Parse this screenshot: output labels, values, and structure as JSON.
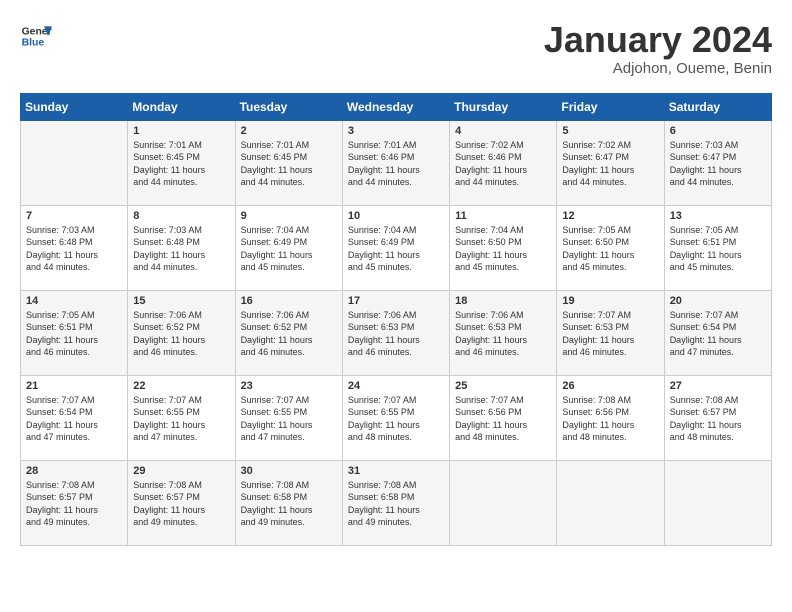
{
  "logo": {
    "line1": "General",
    "line2": "Blue"
  },
  "header": {
    "title": "January 2024",
    "subtitle": "Adjohon, Oueme, Benin"
  },
  "weekdays": [
    "Sunday",
    "Monday",
    "Tuesday",
    "Wednesday",
    "Thursday",
    "Friday",
    "Saturday"
  ],
  "weeks": [
    [
      {
        "day": "",
        "info": ""
      },
      {
        "day": "1",
        "info": "Sunrise: 7:01 AM\nSunset: 6:45 PM\nDaylight: 11 hours\nand 44 minutes."
      },
      {
        "day": "2",
        "info": "Sunrise: 7:01 AM\nSunset: 6:45 PM\nDaylight: 11 hours\nand 44 minutes."
      },
      {
        "day": "3",
        "info": "Sunrise: 7:01 AM\nSunset: 6:46 PM\nDaylight: 11 hours\nand 44 minutes."
      },
      {
        "day": "4",
        "info": "Sunrise: 7:02 AM\nSunset: 6:46 PM\nDaylight: 11 hours\nand 44 minutes."
      },
      {
        "day": "5",
        "info": "Sunrise: 7:02 AM\nSunset: 6:47 PM\nDaylight: 11 hours\nand 44 minutes."
      },
      {
        "day": "6",
        "info": "Sunrise: 7:03 AM\nSunset: 6:47 PM\nDaylight: 11 hours\nand 44 minutes."
      }
    ],
    [
      {
        "day": "7",
        "info": "Sunrise: 7:03 AM\nSunset: 6:48 PM\nDaylight: 11 hours\nand 44 minutes."
      },
      {
        "day": "8",
        "info": "Sunrise: 7:03 AM\nSunset: 6:48 PM\nDaylight: 11 hours\nand 44 minutes."
      },
      {
        "day": "9",
        "info": "Sunrise: 7:04 AM\nSunset: 6:49 PM\nDaylight: 11 hours\nand 45 minutes."
      },
      {
        "day": "10",
        "info": "Sunrise: 7:04 AM\nSunset: 6:49 PM\nDaylight: 11 hours\nand 45 minutes."
      },
      {
        "day": "11",
        "info": "Sunrise: 7:04 AM\nSunset: 6:50 PM\nDaylight: 11 hours\nand 45 minutes."
      },
      {
        "day": "12",
        "info": "Sunrise: 7:05 AM\nSunset: 6:50 PM\nDaylight: 11 hours\nand 45 minutes."
      },
      {
        "day": "13",
        "info": "Sunrise: 7:05 AM\nSunset: 6:51 PM\nDaylight: 11 hours\nand 45 minutes."
      }
    ],
    [
      {
        "day": "14",
        "info": "Sunrise: 7:05 AM\nSunset: 6:51 PM\nDaylight: 11 hours\nand 46 minutes."
      },
      {
        "day": "15",
        "info": "Sunrise: 7:06 AM\nSunset: 6:52 PM\nDaylight: 11 hours\nand 46 minutes."
      },
      {
        "day": "16",
        "info": "Sunrise: 7:06 AM\nSunset: 6:52 PM\nDaylight: 11 hours\nand 46 minutes."
      },
      {
        "day": "17",
        "info": "Sunrise: 7:06 AM\nSunset: 6:53 PM\nDaylight: 11 hours\nand 46 minutes."
      },
      {
        "day": "18",
        "info": "Sunrise: 7:06 AM\nSunset: 6:53 PM\nDaylight: 11 hours\nand 46 minutes."
      },
      {
        "day": "19",
        "info": "Sunrise: 7:07 AM\nSunset: 6:53 PM\nDaylight: 11 hours\nand 46 minutes."
      },
      {
        "day": "20",
        "info": "Sunrise: 7:07 AM\nSunset: 6:54 PM\nDaylight: 11 hours\nand 47 minutes."
      }
    ],
    [
      {
        "day": "21",
        "info": "Sunrise: 7:07 AM\nSunset: 6:54 PM\nDaylight: 11 hours\nand 47 minutes."
      },
      {
        "day": "22",
        "info": "Sunrise: 7:07 AM\nSunset: 6:55 PM\nDaylight: 11 hours\nand 47 minutes."
      },
      {
        "day": "23",
        "info": "Sunrise: 7:07 AM\nSunset: 6:55 PM\nDaylight: 11 hours\nand 47 minutes."
      },
      {
        "day": "24",
        "info": "Sunrise: 7:07 AM\nSunset: 6:55 PM\nDaylight: 11 hours\nand 48 minutes."
      },
      {
        "day": "25",
        "info": "Sunrise: 7:07 AM\nSunset: 6:56 PM\nDaylight: 11 hours\nand 48 minutes."
      },
      {
        "day": "26",
        "info": "Sunrise: 7:08 AM\nSunset: 6:56 PM\nDaylight: 11 hours\nand 48 minutes."
      },
      {
        "day": "27",
        "info": "Sunrise: 7:08 AM\nSunset: 6:57 PM\nDaylight: 11 hours\nand 48 minutes."
      }
    ],
    [
      {
        "day": "28",
        "info": "Sunrise: 7:08 AM\nSunset: 6:57 PM\nDaylight: 11 hours\nand 49 minutes."
      },
      {
        "day": "29",
        "info": "Sunrise: 7:08 AM\nSunset: 6:57 PM\nDaylight: 11 hours\nand 49 minutes."
      },
      {
        "day": "30",
        "info": "Sunrise: 7:08 AM\nSunset: 6:58 PM\nDaylight: 11 hours\nand 49 minutes."
      },
      {
        "day": "31",
        "info": "Sunrise: 7:08 AM\nSunset: 6:58 PM\nDaylight: 11 hours\nand 49 minutes."
      },
      {
        "day": "",
        "info": ""
      },
      {
        "day": "",
        "info": ""
      },
      {
        "day": "",
        "info": ""
      }
    ]
  ]
}
